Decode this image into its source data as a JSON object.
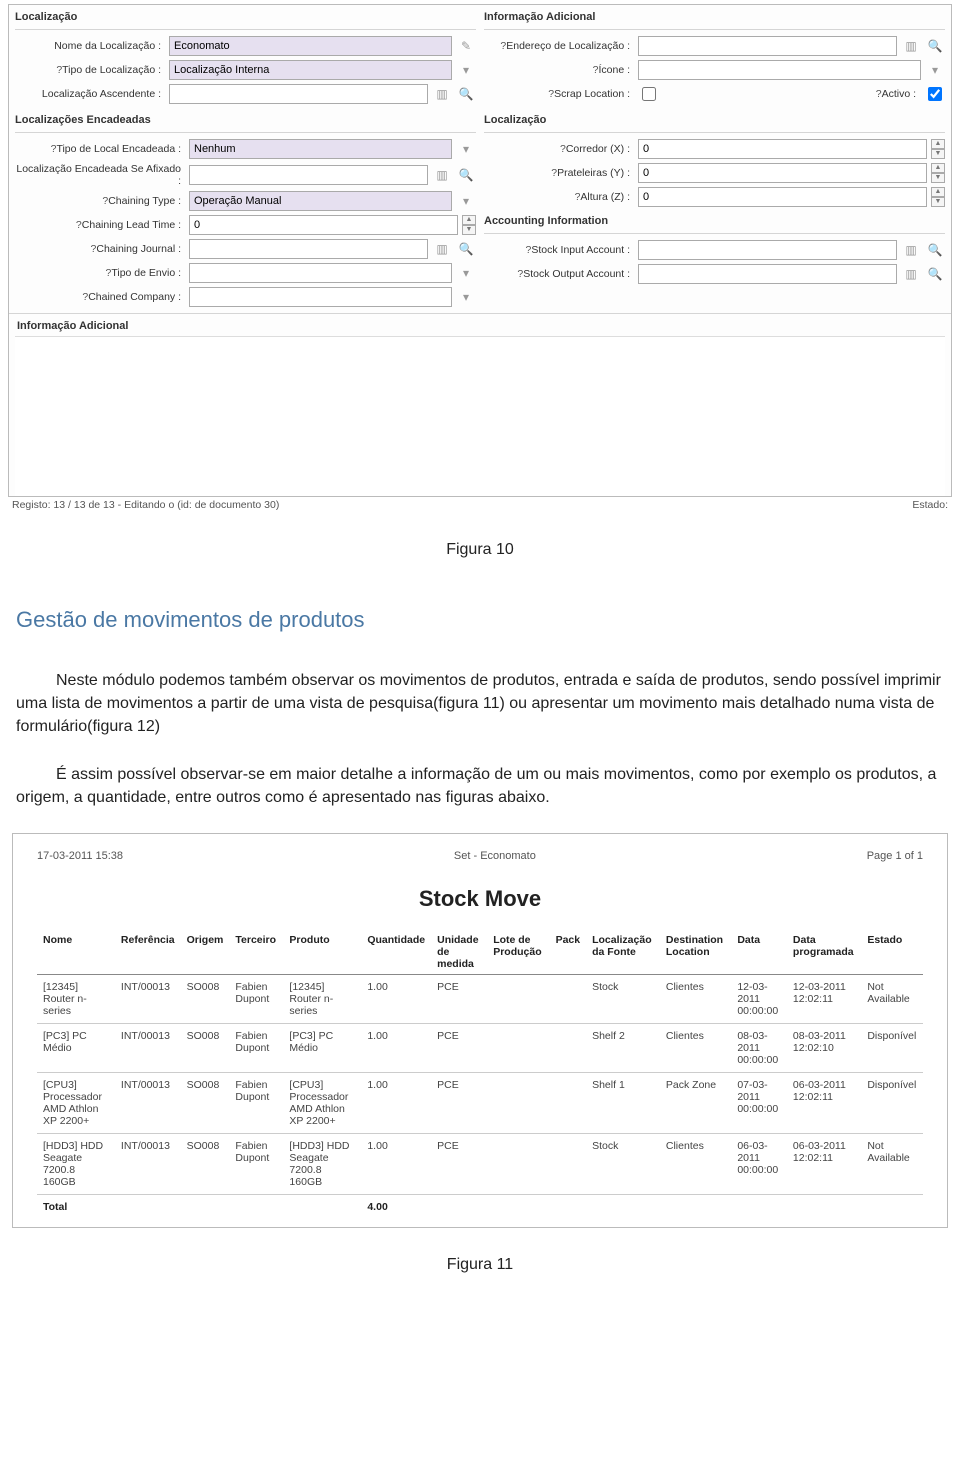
{
  "form": {
    "loc": {
      "title": "Localização",
      "nome_label": "Nome da Localização :",
      "nome_value": "Economato",
      "tipo_label": "Tipo de Localização :",
      "tipo_value": "Localização Interna",
      "asc_label": "Localização Ascendente :",
      "asc_value": ""
    },
    "info_ad": {
      "title": "Informação Adicional",
      "end_label": "Endereço de Localização :",
      "end_value": "",
      "icone_label": "Ícone :",
      "icone_value": "",
      "scrap_label": "Scrap Location :",
      "activo_label": "Activo :"
    },
    "enc": {
      "title": "Localizações Encadeadas",
      "tipo_label": "Tipo de Local Encadeada :",
      "tipo_value": "Nenhum",
      "seafix_label": "Localização Encadeada Se Afixado :",
      "seafix_value": "",
      "ctype_label": "Chaining Type :",
      "ctype_value": "Operação Manual",
      "lead_label": "Chaining Lead Time :",
      "lead_value": "0",
      "journal_label": "Chaining Journal :",
      "journal_value": "",
      "envio_label": "Tipo de Envio :",
      "envio_value": "",
      "company_label": "Chained Company :",
      "company_value": ""
    },
    "loc2": {
      "title": "Localização",
      "x_label": "Corredor (X) :",
      "x_value": "0",
      "y_label": "Prateleiras (Y) :",
      "y_value": "0",
      "z_label": "Altura (Z) :",
      "z_value": "0"
    },
    "acct": {
      "title": "Accounting Information",
      "in_label": "Stock Input Account :",
      "in_value": "",
      "out_label": "Stock Output Account :",
      "out_value": ""
    },
    "info_bar": "Informação Adicional",
    "status_left": "Registo: 13 / 13 de 13 - Editando o (id: de documento 30)",
    "status_right": "Estado:"
  },
  "fig10": "Figura 10",
  "heading": "Gestão de movimentos de produtos",
  "para1": "Neste módulo podemos também observar os movimentos de produtos, entrada e saída de produtos, sendo possível imprimir uma lista de movimentos a partir de uma vista de pesquisa(figura 11) ou apresentar um movimento mais detalhado numa vista de formulário(figura 12)",
  "para2": "É assim possível observar-se em maior detalhe a informação de um ou mais movimentos, como por exemplo os produtos, a origem, a quantidade, entre outros como é apresentado nas figuras abaixo.",
  "report": {
    "date": "17-03-2011 15:38",
    "center": "Set - Economato",
    "page": "Page 1 of 1",
    "title": "Stock Move",
    "headers": [
      "Nome",
      "Referência",
      "Origem",
      "Terceiro",
      "Produto",
      "Quantidade",
      "Unidade de medida",
      "Lote de Produção",
      "Pack",
      "Localização da Fonte",
      "Destination Location",
      "Data",
      "Data programada",
      "Estado"
    ],
    "rows": [
      {
        "nome": "[12345] Router n-series",
        "ref": "INT/00013",
        "origem": "SO008",
        "terc": "Fabien Dupont",
        "prod": "[12345] Router n-series",
        "qty": "1.00",
        "uom": "PCE",
        "lote": "",
        "pack": "",
        "fonte": "Stock",
        "dest": "Clientes",
        "data": "12-03-2011 00:00:00",
        "dprog": "12-03-2011 12:02:11",
        "estado": "Not Available"
      },
      {
        "nome": "[PC3] PC Médio",
        "ref": "INT/00013",
        "origem": "SO008",
        "terc": "Fabien Dupont",
        "prod": "[PC3] PC Médio",
        "qty": "1.00",
        "uom": "PCE",
        "lote": "",
        "pack": "",
        "fonte": "Shelf 2",
        "dest": "Clientes",
        "data": "08-03-2011 00:00:00",
        "dprog": "08-03-2011 12:02:10",
        "estado": "Disponível"
      },
      {
        "nome": "[CPU3] Processador AMD Athlon XP 2200+",
        "ref": "INT/00013",
        "origem": "SO008",
        "terc": "Fabien Dupont",
        "prod": "[CPU3] Processador AMD Athlon XP 2200+",
        "qty": "1.00",
        "uom": "PCE",
        "lote": "",
        "pack": "",
        "fonte": "Shelf 1",
        "dest": "Pack Zone",
        "data": "07-03-2011 00:00:00",
        "dprog": "06-03-2011 12:02:11",
        "estado": "Disponível"
      },
      {
        "nome": "[HDD3] HDD Seagate 7200.8 160GB",
        "ref": "INT/00013",
        "origem": "SO008",
        "terc": "Fabien Dupont",
        "prod": "[HDD3] HDD Seagate 7200.8 160GB",
        "qty": "1.00",
        "uom": "PCE",
        "lote": "",
        "pack": "",
        "fonte": "Stock",
        "dest": "Clientes",
        "data": "06-03-2011 00:00:00",
        "dprog": "06-03-2011 12:02:11",
        "estado": "Not Available"
      }
    ],
    "total_label": "Total",
    "total_qty": "4.00"
  },
  "fig11": "Figura 11"
}
